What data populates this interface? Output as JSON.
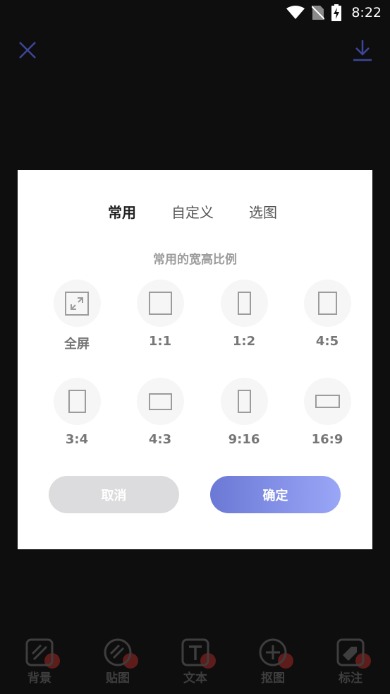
{
  "status_bar": {
    "time": "8:22"
  },
  "toolbar": {
    "items": [
      {
        "label": "背景",
        "icon": "background-icon"
      },
      {
        "label": "贴图",
        "icon": "sticker-icon"
      },
      {
        "label": "文本",
        "icon": "text-icon"
      },
      {
        "label": "抠图",
        "icon": "cutout-icon"
      },
      {
        "label": "标注",
        "icon": "tag-icon"
      }
    ]
  },
  "dialog": {
    "tabs": [
      {
        "label": "常用",
        "active": true
      },
      {
        "label": "自定义",
        "active": false
      },
      {
        "label": "选图",
        "active": false
      }
    ],
    "subtitle": "常用的宽高比例",
    "ratios": [
      {
        "label": "全屏",
        "value": "fullscreen"
      },
      {
        "label": "1:1",
        "value": 1.0
      },
      {
        "label": "1:2",
        "value": 0.5
      },
      {
        "label": "4:5",
        "value": 0.8
      },
      {
        "label": "3:4",
        "value": 0.75
      },
      {
        "label": "4:3",
        "value": 1.333
      },
      {
        "label": "9:16",
        "value": 0.5625
      },
      {
        "label": "16:9",
        "value": 1.778
      }
    ],
    "cancel_label": "取消",
    "confirm_label": "确定"
  },
  "colors": {
    "accent_start": "#6b79d6",
    "accent_end": "#9aa6f6",
    "top_icon": "#3d4699"
  }
}
